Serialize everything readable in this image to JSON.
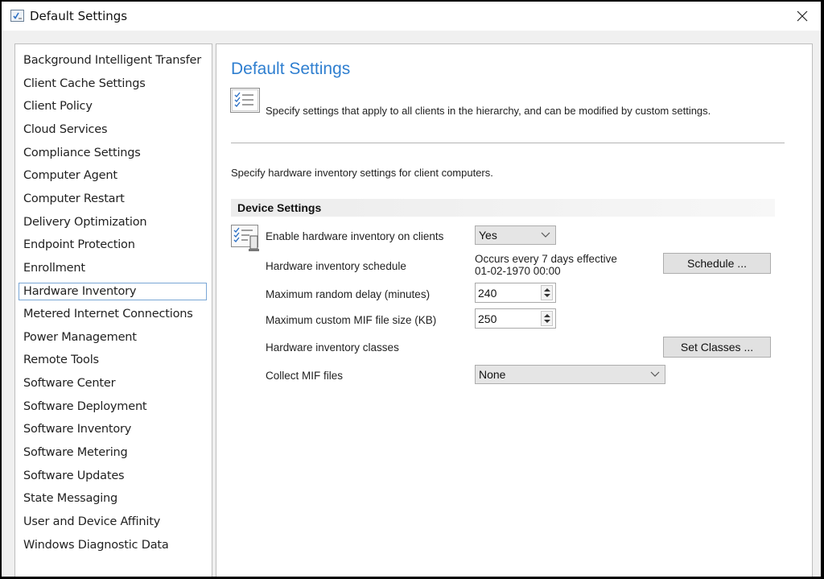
{
  "window": {
    "title": "Default Settings",
    "title_icon": "settings-checklist-icon",
    "close_icon": "close-icon"
  },
  "sidebar": {
    "selected_index": 10,
    "items": [
      {
        "label": "Background Intelligent Transfer"
      },
      {
        "label": "Client Cache Settings"
      },
      {
        "label": "Client Policy"
      },
      {
        "label": "Cloud Services"
      },
      {
        "label": "Compliance Settings"
      },
      {
        "label": "Computer Agent"
      },
      {
        "label": "Computer Restart"
      },
      {
        "label": "Delivery Optimization"
      },
      {
        "label": "Endpoint Protection"
      },
      {
        "label": "Enrollment"
      },
      {
        "label": "Hardware Inventory"
      },
      {
        "label": "Metered Internet Connections"
      },
      {
        "label": "Power Management"
      },
      {
        "label": "Remote Tools"
      },
      {
        "label": "Software Center"
      },
      {
        "label": "Software Deployment"
      },
      {
        "label": "Software Inventory"
      },
      {
        "label": "Software Metering"
      },
      {
        "label": "Software Updates"
      },
      {
        "label": "State Messaging"
      },
      {
        "label": "User and Device Affinity"
      },
      {
        "label": "Windows Diagnostic Data"
      }
    ]
  },
  "main": {
    "title": "Default Settings",
    "header_icon": "checklist-icon",
    "description": "Specify settings that apply to all clients in the hierarchy, and can be modified by custom settings.",
    "section_description": "Specify hardware inventory settings for client computers.",
    "group_title": "Device Settings",
    "group_icon": "hardware-inventory-icon",
    "settings": {
      "enable": {
        "label": "Enable hardware inventory on clients",
        "value": "Yes"
      },
      "schedule": {
        "label": "Hardware inventory schedule",
        "line1": "Occurs every 7 days effective",
        "line2": "01-02-1970 00:00",
        "button": "Schedule ..."
      },
      "random_delay": {
        "label": "Maximum random delay (minutes)",
        "value": "240"
      },
      "mif_size": {
        "label": "Maximum custom MIF file size (KB)",
        "value": "250"
      },
      "classes": {
        "label": "Hardware inventory classes",
        "button": "Set Classes ..."
      },
      "collect_mif": {
        "label": "Collect MIF files",
        "value": "None"
      }
    }
  },
  "colors": {
    "accent": "#2f7fd0",
    "selection_border": "#7aa7d6"
  }
}
